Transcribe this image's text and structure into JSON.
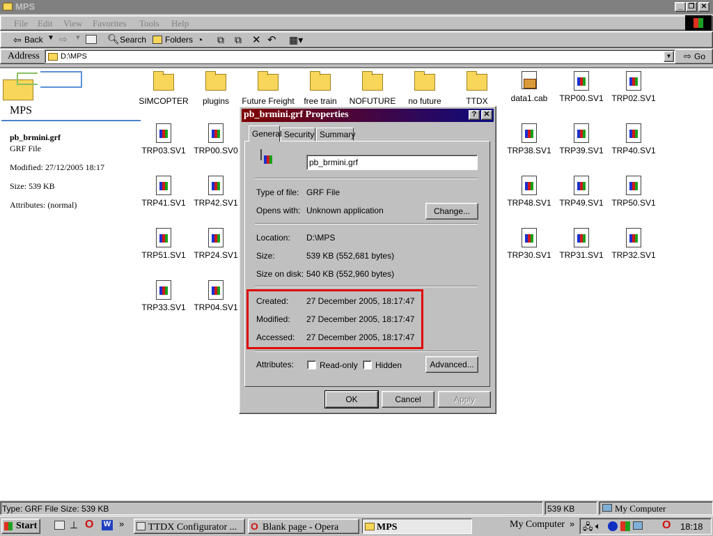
{
  "window": {
    "title": "MPS"
  },
  "menu": [
    "File",
    "Edit",
    "View",
    "Favorites",
    "Tools",
    "Help"
  ],
  "toolbar": {
    "back": "Back",
    "search": "Search",
    "folders": "Folders"
  },
  "address": {
    "label": "Address",
    "value": "D:\\MPS",
    "go": "Go"
  },
  "sidebar": {
    "folder_title": "MPS",
    "file_name": "pb_brmini.grf",
    "file_type": "GRF File",
    "modified": "Modified: 27/12/2005 18:17",
    "size": "Size: 539 KB",
    "attributes": "Attributes: (normal)"
  },
  "files": [
    "SIMCOPTER",
    "plugins",
    "Future Freight",
    "free train",
    "NOFUTURE",
    "no future",
    "TTDX",
    "data1.cab",
    "TRP00.SV1",
    "TRP02.SV1",
    "TRP03.SV1",
    "TRP00.SV0",
    "TRP38.SV1",
    "TRP39.SV1",
    "TRP40.SV1",
    "TRP41.SV1",
    "TRP42.SV1",
    "TRP48.SV1",
    "TRP49.SV1",
    "TRP50.SV1",
    "TRP51.SV1",
    "TRP24.SV1",
    "TRP30.SV1",
    "TRP31.SV1",
    "TRP32.SV1",
    "TRP33.SV1",
    "TRP04.SV1"
  ],
  "dialog": {
    "title": "pb_brmini.grf Properties",
    "tabs": [
      "General",
      "Security",
      "Summary"
    ],
    "filename": "pb_brmini.grf",
    "type_label": "Type of file:",
    "type_value": "GRF File",
    "opens_label": "Opens with:",
    "opens_value": "Unknown application",
    "change": "Change...",
    "location_label": "Location:",
    "location_value": "D:\\MPS",
    "size_label": "Size:",
    "size_value": "539 KB (552,681 bytes)",
    "disk_label": "Size on disk:",
    "disk_value": "540 KB (552,960 bytes)",
    "created_label": "Created:",
    "created_value": "27 December 2005, 18:17:47",
    "modified_label": "Modified:",
    "modified_value": "27 December 2005, 18:17:47",
    "accessed_label": "Accessed:",
    "accessed_value": "27 December 2005, 18:17:47",
    "attributes_label": "Attributes:",
    "readonly": "Read-only",
    "hidden": "Hidden",
    "advanced": "Advanced...",
    "ok": "OK",
    "cancel": "Cancel",
    "apply": "Apply",
    "highlight_color": "#e00000"
  },
  "status": {
    "left": "Type: GRF File Size: 539 KB",
    "size": "539 KB",
    "zone": "My Computer"
  },
  "taskbar": {
    "start": "Start",
    "tasks": [
      "TTDX Configurator ...",
      "Blank page - Opera",
      "MPS"
    ],
    "mycomputer": "My Computer",
    "clock": "18:18"
  }
}
